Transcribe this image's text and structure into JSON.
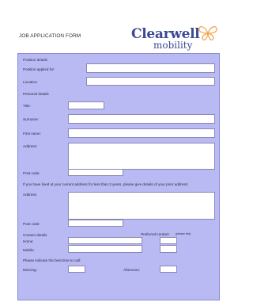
{
  "header": {
    "title": "JOB APPLICATION FORM",
    "logo_word1": "Clearwell",
    "logo_word2": "mobility"
  },
  "colors": {
    "panel": "#b9b9f3",
    "brand_blue": "#3b4a93",
    "butterfly_orange": "#f0a24a"
  },
  "sections": {
    "position_details": "Position details",
    "personal_details": "Personal details",
    "prior_address_note": "If you have lived at your current address for less than 3 years, please give details of your prior address:",
    "contact_details": "Contact details",
    "preferred_contact": "Preferred contact:",
    "preferred_contact_hint": "(please tick)",
    "best_time": "Please indicate the best time to call:"
  },
  "fields": {
    "position_applied": "Position applied for:",
    "location": "Location:",
    "title": "Title:",
    "surname": "Surname:",
    "first_name": "First name:",
    "address": "Address:",
    "post_code": "Post code:",
    "prior_address": "Address:",
    "prior_post_code": "Post code:",
    "home": "Home:",
    "mobile": "Mobile:",
    "morning": "Morning:",
    "afternoon": "Afternoon:"
  }
}
